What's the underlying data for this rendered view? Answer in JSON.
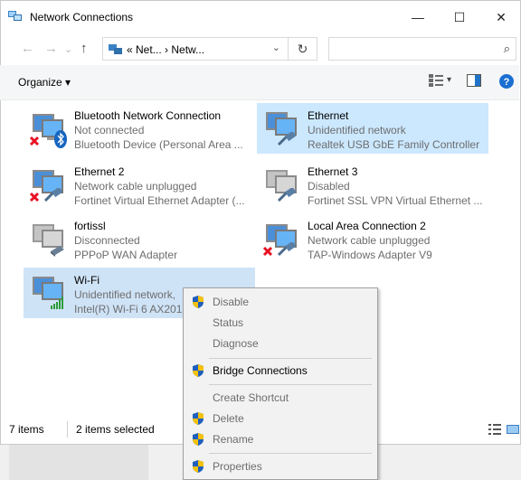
{
  "window": {
    "title": "Network Connections"
  },
  "address": {
    "text": "« Net...  ›  Netw..."
  },
  "toolbar": {
    "organize": "Organize ▾"
  },
  "items": [
    {
      "name": "Bluetooth Network Connection",
      "status": "Not connected",
      "device": "Bluetooth Device (Personal Area ..."
    },
    {
      "name": "Ethernet",
      "status": "Unidentified network",
      "device": "Realtek USB GbE Family Controller"
    },
    {
      "name": "Ethernet 2",
      "status": "Network cable unplugged",
      "device": "Fortinet Virtual Ethernet Adapter (..."
    },
    {
      "name": "Ethernet 3",
      "status": "Disabled",
      "device": "Fortinet SSL VPN Virtual Ethernet ..."
    },
    {
      "name": "fortissl",
      "status": "Disconnected",
      "device": "PPPoP WAN Adapter"
    },
    {
      "name": "Local Area Connection 2",
      "status": "Network cable unplugged",
      "device": "TAP-Windows Adapter V9"
    },
    {
      "name": "Wi-Fi",
      "status": "Unidentified network,",
      "device": "Intel(R) Wi-Fi 6 AX201"
    }
  ],
  "status": {
    "count": "7 items",
    "selected": "2 items selected"
  },
  "context_menu": {
    "disable": "Disable",
    "status": "Status",
    "diagnose": "Diagnose",
    "bridge": "Bridge Connections",
    "shortcut": "Create Shortcut",
    "delete": "Delete",
    "rename": "Rename",
    "properties": "Properties"
  },
  "colors": {
    "selection": "#cce8ff",
    "accent": "#0078d7",
    "error": "#e81123"
  }
}
